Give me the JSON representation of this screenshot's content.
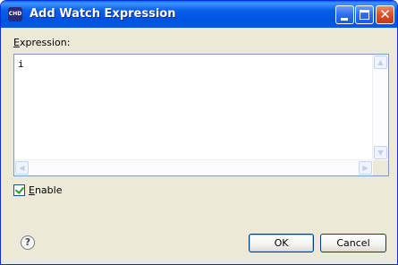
{
  "window": {
    "title": "Add Watch Expression",
    "app_icon": "CHD",
    "controls": [
      "minimize-icon",
      "maximize-icon",
      "close-icon"
    ]
  },
  "form": {
    "expression_label_prefix": "E",
    "expression_label_rest": "xpression:",
    "expression_value": "i",
    "enable_label_prefix": "E",
    "enable_label_rest": "nable",
    "enable_checked": true
  },
  "buttons": {
    "ok": "OK",
    "cancel": "Cancel"
  },
  "help_glyph": "?",
  "colors": {
    "titlebar": "#0a5fea",
    "dialog_bg": "#ece9d8",
    "close_button": "#d9502a"
  }
}
